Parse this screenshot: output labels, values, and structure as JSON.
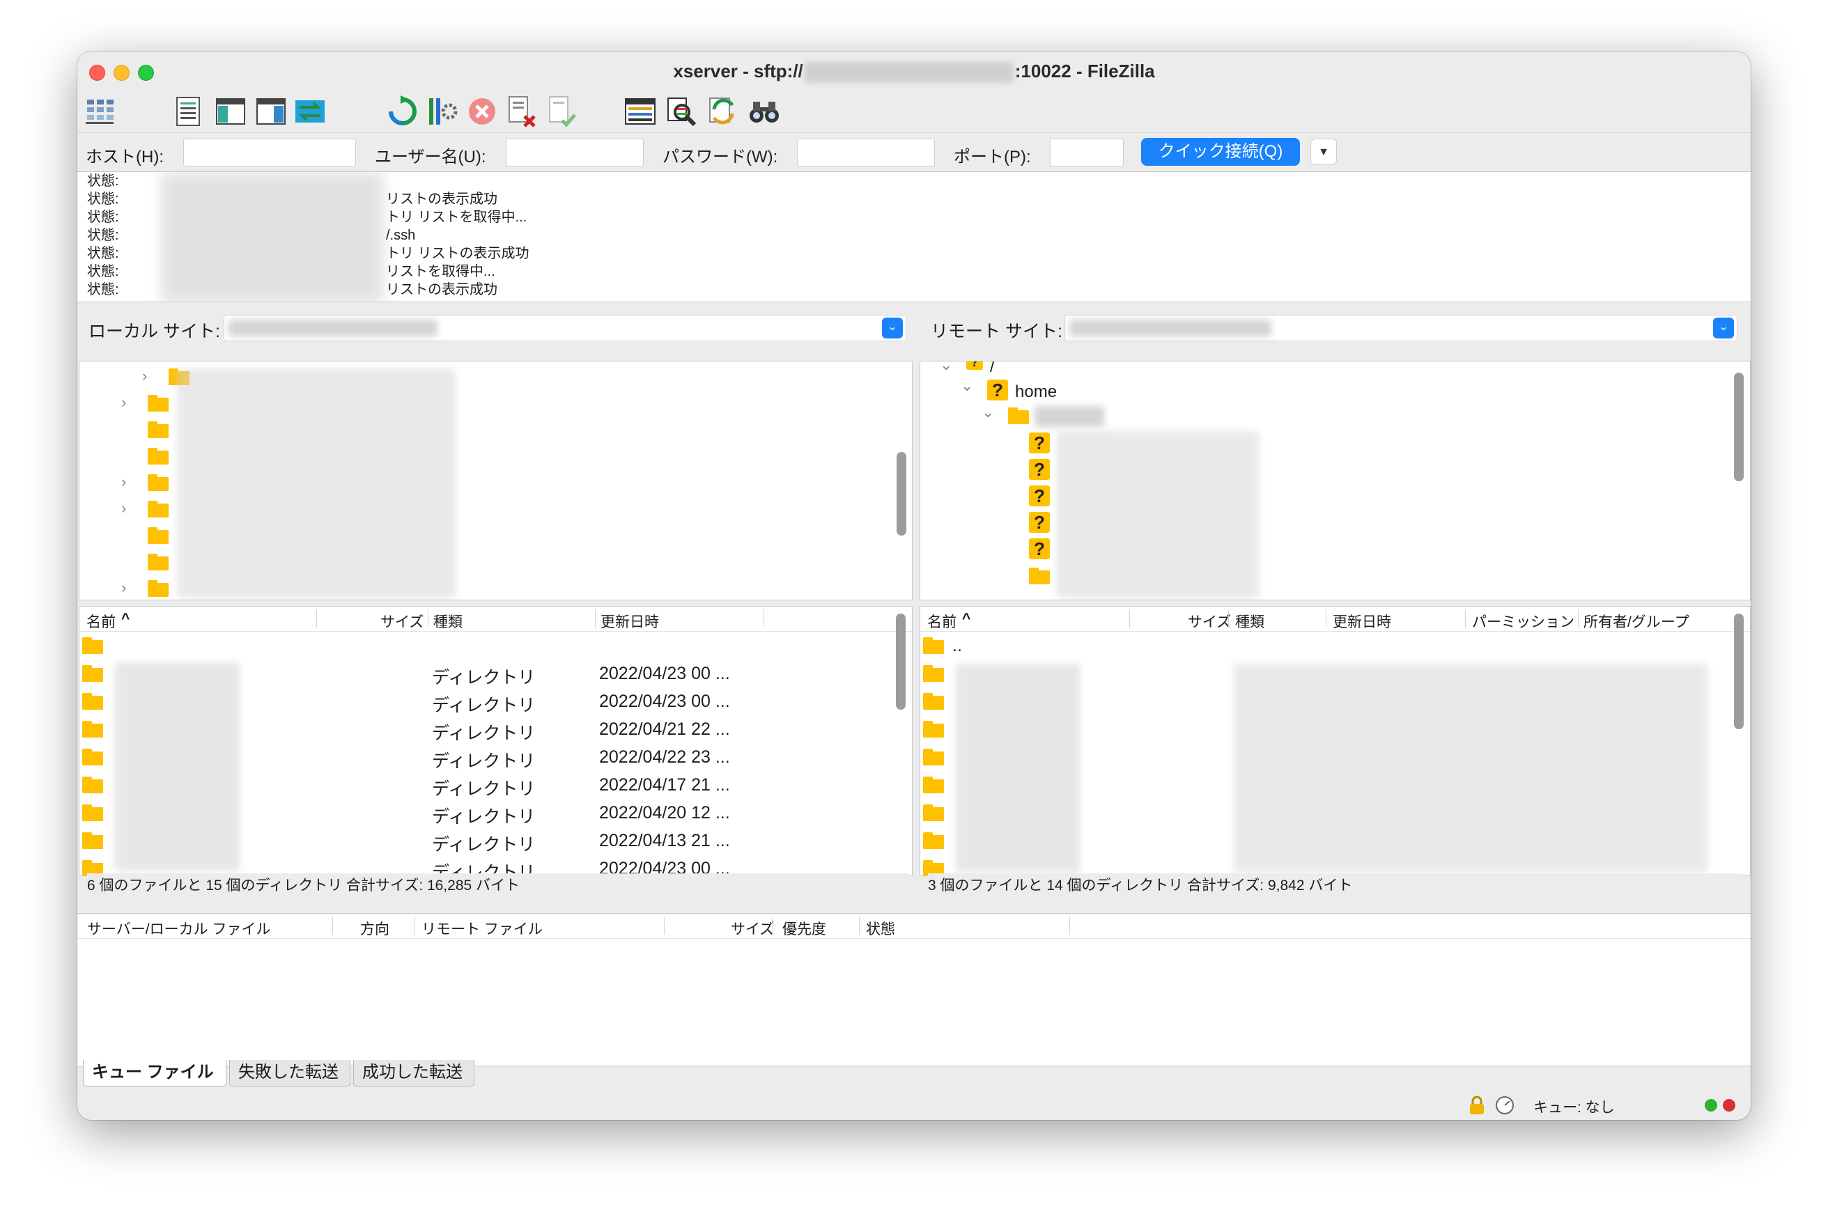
{
  "window": {
    "title_prefix": "xserver - sftp://",
    "title_suffix": ":10022 - FileZilla"
  },
  "toolbar": {
    "icons": [
      "site-manager-icon",
      "message-log-icon",
      "local-tree-icon",
      "remote-tree-icon",
      "transfer-queue-icon",
      "refresh-icon",
      "process-queue-icon",
      "cancel-icon",
      "disconnect-icon",
      "reconnect-icon",
      "directory-listing-filter-icon",
      "dir-compare-icon",
      "sync-browse-icon",
      "search-icon"
    ]
  },
  "quickconnect": {
    "host_label": "ホスト(H):",
    "host_value": "",
    "user_label": "ユーザー名(U):",
    "user_value": "",
    "pass_label": "パスワード(W):",
    "pass_value": "",
    "port_label": "ポート(P):",
    "port_value": "",
    "connect_button": "クイック接続(Q)",
    "dropdown_arrow": "▼"
  },
  "log": {
    "lines": [
      {
        "label": "状態:",
        "msg": ""
      },
      {
        "label": "状態:",
        "msg": "リストの表示成功"
      },
      {
        "label": "状態:",
        "msg": "トリ リストを取得中..."
      },
      {
        "label": "状態:",
        "msg": "/.ssh"
      },
      {
        "label": "状態:",
        "msg": "トリ リストの表示成功"
      },
      {
        "label": "状態:",
        "msg": "リストを取得中..."
      },
      {
        "label": "状態:",
        "msg": "リストの表示成功"
      }
    ]
  },
  "local": {
    "site_label": "ローカル サイト:",
    "columns": [
      "名前",
      "サイズ",
      "種類",
      "更新日時"
    ],
    "sort_indicator": "^",
    "rows": [
      {
        "type": "",
        "date": ""
      },
      {
        "type": "ディレクトリ",
        "date": "2022/04/23 00 ..."
      },
      {
        "type": "ディレクトリ",
        "date": "2022/04/23 00 ..."
      },
      {
        "type": "ディレクトリ",
        "date": "2022/04/21 22 ..."
      },
      {
        "type": "ディレクトリ",
        "date": "2022/04/22 23 ..."
      },
      {
        "type": "ディレクトリ",
        "date": "2022/04/17 21 ..."
      },
      {
        "type": "ディレクトリ",
        "date": "2022/04/20 12 ..."
      },
      {
        "type": "ディレクトリ",
        "date": "2022/04/13 21 ..."
      },
      {
        "type": "ディレクトリ",
        "date": "2022/04/23 00 ..."
      }
    ],
    "status": "6 個のファイルと 15 個のディレクトリ 合計サイズ: 16,285 バイト"
  },
  "remote": {
    "site_label": "リモート サイト:",
    "tree_root": "/",
    "tree_home": "home",
    "columns": [
      "名前",
      "サイズ",
      "種類",
      "更新日時",
      "パーミッション",
      "所有者/グループ"
    ],
    "sort_indicator": "^",
    "parent_dir": "..",
    "status": "3 個のファイルと 14 個のディレクトリ 合計サイズ: 9,842 バイト"
  },
  "queue": {
    "columns": [
      "サーバー/ローカル ファイル",
      "方向",
      "リモート ファイル",
      "サイズ",
      "優先度",
      "状態"
    ],
    "tabs": [
      "キュー ファイル",
      "失敗した転送",
      "成功した転送"
    ]
  },
  "statusbar": {
    "queue_text": "キュー: なし"
  },
  "colors": {
    "accent": "#1a82fb",
    "folder": "#ffc000",
    "led_green": "#2fb12f",
    "led_red": "#d93030"
  }
}
